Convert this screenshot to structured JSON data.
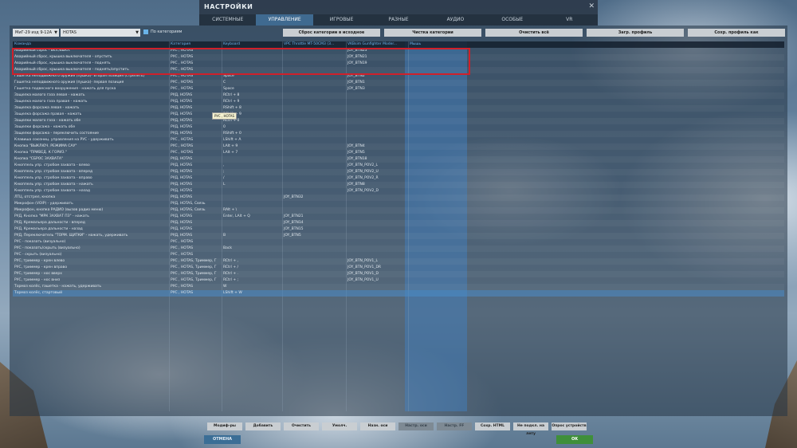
{
  "window": {
    "title": "НАСТРОЙКИ",
    "close": "✕"
  },
  "tabs": [
    "СИСТЕМНЫЕ",
    "УПРАВЛЕНИЕ",
    "ИГРОВЫЕ",
    "РАЗНЫЕ",
    "АУДИО",
    "ОСОБЫЕ",
    "VR"
  ],
  "active_tab": 1,
  "toolbar": {
    "aircraft": "МиГ-29 изд 9-12А",
    "mode": "HOTAS",
    "by_category": "По категориям",
    "buttons": [
      "Сброс категории в исходное",
      "Чистка категории",
      "Очистить всё",
      "Загр. профиль",
      "Сохр. профиль как"
    ]
  },
  "columns": [
    "Команда",
    "Категория",
    "Keyboard",
    "VPC Throttle MT-50CM3 (3...",
    "VKBsim Gunfighter Moder...",
    "Мышь"
  ],
  "rows": [
    [
      "Аварийный сброс - вкл./выкл.",
      "РУС , HOTAS",
      "",
      "",
      "JOY_BTN23",
      ""
    ],
    [
      "Аварийный сброс, крышка выключателя - опустить",
      "РУС , HOTAS",
      "",
      "",
      "JOY_BTN21",
      ""
    ],
    [
      "Аварийный сброс, крышка выключателя - поднять",
      "РУС , HOTAS",
      "",
      "",
      "JOY_BTN19",
      ""
    ],
    [
      "Аварийный сброс, крышка выключателя - поднять/опустить",
      "РУС , HOTAS",
      "",
      "",
      "",
      ""
    ],
    [
      "Гашетка неподвижного оружия (пушка)- вторая позиция (стрелять)",
      "РУС , HOTAS",
      "Space",
      "",
      "JOY_BTN2",
      ""
    ],
    [
      "Гашетка неподвижного оружия (пушка)- первая позиция",
      "РУС , HOTAS",
      "C",
      "",
      "JOY_BTN1",
      ""
    ],
    [
      "Гашетка подвесного вооружения - нажать для пуска",
      "РУС , HOTAS",
      "Space",
      "",
      "JOY_BTN3",
      ""
    ],
    [
      "Защелка малого газа левая - нажать",
      "РУД, HOTAS",
      "RCtrl + 8",
      "",
      "",
      ""
    ],
    [
      "Защелка малого газа правая - нажать",
      "РУД, HOTAS",
      "RCtrl + 9",
      "",
      "",
      ""
    ],
    [
      "Защелка форсажа левая - нажать",
      "РУД, HOTAS",
      "RShift + 8",
      "",
      "",
      ""
    ],
    [
      "Защелка форсажа правая - нажать",
      "РУД, HOTAS",
      "RShift + 9",
      "",
      "",
      ""
    ],
    [
      "Защелки малого газа - нажать обе",
      "РУД, HOTAS",
      "RCtrl + 0",
      "",
      "",
      ""
    ],
    [
      "Защелки форсажа - нажать обе",
      "РУД, HOTAS",
      "0",
      "",
      "",
      ""
    ],
    [
      "Защелки форсажа - переключить состояние",
      "РУД, HOTAS",
      "RShift + 0",
      "",
      "",
      ""
    ],
    [
      "Клавиша союзниц. управления на РУС - удерживать",
      "РУС , HOTAS",
      "LShift + A",
      "",
      "",
      ""
    ],
    [
      "Кнопка \"ВЫКЛЮЧ. РЕЖИМА САУ\"",
      "РУС , HOTAS",
      "LAlt + 9",
      "",
      "JOY_BTN4",
      ""
    ],
    [
      "Кнопка \"ПРИВЕД. К ГОРИЗ.\"",
      "РУС , HOTAS",
      "LAlt + 7",
      "",
      "JOY_BTN5",
      ""
    ],
    [
      "Кнопка \"СБРОС ЗАХВАТА\"",
      "РУД, HOTAS",
      "",
      "",
      "JOY_BTN18",
      ""
    ],
    [
      "Кнюппель упр. стробом захвата - влево",
      "РУД, HOTAS",
      ",",
      "",
      "JOY_BTN_POV2_L",
      ""
    ],
    [
      "Кнюппель упр. стробом захвата - вперед",
      "РУД, HOTAS",
      ";",
      "",
      "JOY_BTN_POV2_U",
      ""
    ],
    [
      "Кнюппель упр. стробом захвата - вправо",
      "РУД, HOTAS",
      "/",
      "",
      "JOY_BTN_POV2_R",
      ""
    ],
    [
      "Кнюппель упр. стробом захвата - нажать",
      "РУД, HOTAS",
      "L",
      "",
      "JOY_BTN8",
      ""
    ],
    [
      "Кнюппель упр. стробом захвата - назад",
      "РУД, HOTAS",
      "",
      "",
      "JOY_BTN_POV2_D",
      ""
    ],
    [
      "ЛТЦ, отстрел, кнопка",
      "РУД, HOTAS",
      "",
      "JOY_BTN32",
      "",
      ""
    ],
    [
      "Микрофон (VOIP) - удерживать",
      "РУД, HOTAS, Связь",
      "",
      "",
      "",
      ""
    ],
    [
      "Микрофон, кнопка РАДИО (вызов радио меню)",
      "РУД, HOTAS, Связь",
      "RAlt + \\",
      "",
      "",
      ""
    ],
    [
      "РУД, Кнопка \"МРК ЗАХВАТ ПЗ\" - нажать",
      "РУД, HOTAS",
      "Enter, LAlt + Q",
      "JOY_BTN21",
      "",
      ""
    ],
    [
      "РУД, Кремальера дальности - вперед",
      "РУД, HOTAS",
      "",
      "JOY_BTN14",
      "",
      ""
    ],
    [
      "РУД, Кремальера дальности - назад",
      "РУД, HOTAS",
      "",
      "JOY_BTN15",
      "",
      ""
    ],
    [
      "РУД, Переключатель \"ТОРМ. ЩИТКИ\" - нажать, удерживать",
      "РУД, HOTAS",
      "B",
      "JOY_BTN5",
      "",
      ""
    ],
    [
      "РУС - показать (визуально)",
      "РУС , HOTAS",
      "",
      "",
      "",
      ""
    ],
    [
      "РУС - показать/скрыть (визуально)",
      "РУС , HOTAS",
      "Back",
      "",
      "",
      ""
    ],
    [
      "РУС - скрыть (визуально)",
      "РУС , HOTAS",
      "",
      "",
      "",
      ""
    ],
    [
      "РУС, триммер - крен влево",
      "РУС , HOTAS, Триммер, Г",
      "RCtrl + ,",
      "",
      "JOY_BTN_POV1_L",
      ""
    ],
    [
      "РУС, триммер - крен вправо",
      "РУС , HOTAS, Триммер, Г",
      "RCtrl + /",
      "",
      "JOY_BTN_POV1_DR",
      ""
    ],
    [
      "РУС, триммер - нос вверх",
      "РУС , HOTAS, Триммер, Г",
      "RCtrl + .",
      "",
      "JOY_BTN_POV1_D",
      ""
    ],
    [
      "РУС, триммер - нос вниз",
      "РУС , HOTAS, Триммер, Г",
      "RCtrl + ;",
      "",
      "JOY_BTN_POV1_U",
      ""
    ],
    [
      "Тормоз колёс, гашетка - нажать, удерживать",
      "РУС , HOTAS",
      "W",
      "",
      "",
      ""
    ],
    [
      "Тормоз колёс, стартовый",
      "РУС , HOTAS",
      "LShift + W",
      "",
      "",
      ""
    ]
  ],
  "selected_row": 38,
  "tooltip": "РУС , HOTAS",
  "footer_buttons": [
    {
      "label": "Модиф-ры",
      "disabled": false
    },
    {
      "label": "Добавить",
      "disabled": false
    },
    {
      "label": "Очистить",
      "disabled": false
    },
    {
      "label": "Умолч.",
      "disabled": false
    },
    {
      "label": "Назн. оси",
      "disabled": false
    },
    {
      "label": "Настр. оси",
      "disabled": true
    },
    {
      "label": "Настр. FF",
      "disabled": true
    },
    {
      "label": "Сохр. HTML",
      "disabled": false
    },
    {
      "label": "Не подкл. на лету",
      "disabled": false
    },
    {
      "label": "Опрос устройств",
      "disabled": false
    }
  ],
  "cancel": "ОТМЕНА",
  "ok": "OK"
}
